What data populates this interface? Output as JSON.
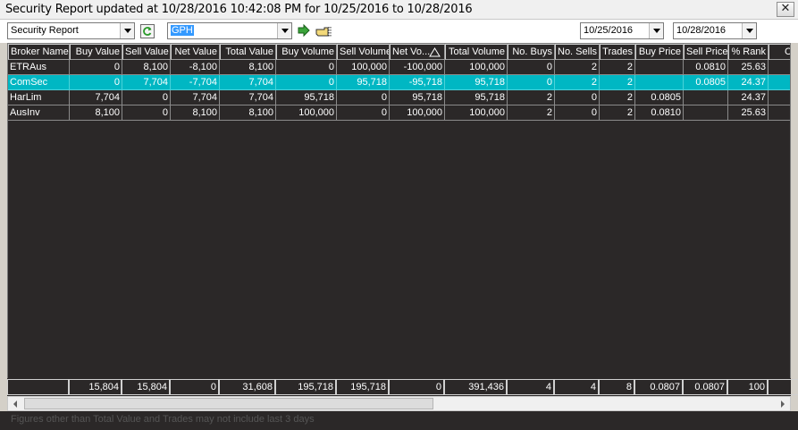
{
  "window": {
    "title": "Security Report updated at 10/28/2016 10:42:08 PM for 10/25/2016 to 10/28/2016",
    "close_label": "✕"
  },
  "toolbar": {
    "report_select": "Security Report",
    "security_code": "GPH",
    "date_from": "10/25/2016",
    "date_to": "10/28/2016",
    "refresh_icon": "refresh-icon",
    "go_icon": "go-arrow-icon",
    "export_icon": "hand-pointer-icon"
  },
  "table": {
    "columns": [
      "Broker Name",
      "Buy Value",
      "Sell Value",
      "Net Value",
      "Total Value",
      "Buy Volume",
      "Sell Volume",
      "Net Vo...",
      "Total Volume",
      "No. Buys",
      "No. Sells",
      "Trades",
      "Buy Price",
      "Sell Price",
      "% Rank",
      "Call"
    ],
    "rows": [
      [
        "ETRAus",
        "0",
        "8,100",
        "-8,100",
        "8,100",
        "0",
        "100,000",
        "-100,000",
        "100,000",
        "0",
        "2",
        "2",
        "",
        "0.0810",
        "25.63",
        ""
      ],
      [
        "ComSec",
        "0",
        "7,704",
        "-7,704",
        "7,704",
        "0",
        "95,718",
        "-95,718",
        "95,718",
        "0",
        "2",
        "2",
        "",
        "0.0805",
        "24.37",
        ""
      ],
      [
        "HarLim",
        "7,704",
        "0",
        "7,704",
        "7,704",
        "95,718",
        "0",
        "95,718",
        "95,718",
        "2",
        "0",
        "2",
        "0.0805",
        "",
        "24.37",
        ""
      ],
      [
        "AusInv",
        "8,100",
        "0",
        "8,100",
        "8,100",
        "100,000",
        "0",
        "100,000",
        "100,000",
        "2",
        "0",
        "2",
        "0.0810",
        "",
        "25.63",
        ""
      ]
    ],
    "selected_row": 1,
    "totals": [
      "",
      "15,804",
      "15,804",
      "0",
      "31,608",
      "195,718",
      "195,718",
      "0",
      "391,436",
      "4",
      "4",
      "8",
      "0.0807",
      "0.0807",
      "100",
      ""
    ]
  },
  "status": {
    "text": "Figures other than Total Value and Trades may not include last 3 days"
  },
  "colors": {
    "grid_bg": "#2b2828",
    "selected_row": "#00b7c3"
  }
}
